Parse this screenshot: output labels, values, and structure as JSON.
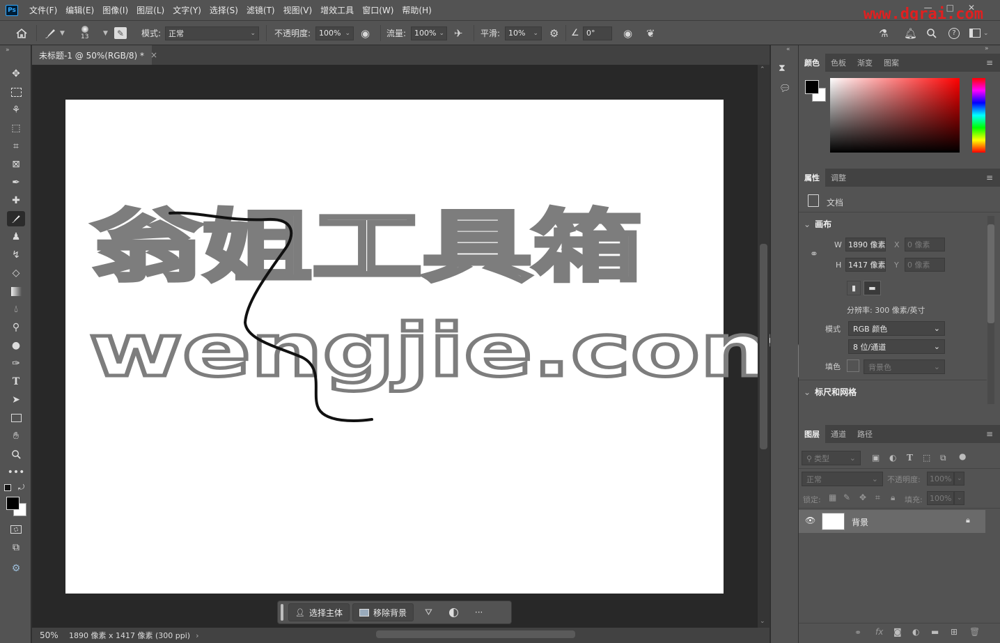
{
  "app": {
    "logo": "Ps",
    "watermark": "www.dgrai.com"
  },
  "menu": [
    "文件(F)",
    "编辑(E)",
    "图像(I)",
    "图层(L)",
    "文字(Y)",
    "选择(S)",
    "滤镜(T)",
    "视图(V)",
    "增效工具",
    "窗口(W)",
    "帮助(H)"
  ],
  "window_controls": {
    "minimize": "—",
    "restore": "□",
    "close": "✕"
  },
  "options": {
    "brush_size": "13",
    "mode_label": "模式:",
    "mode_value": "正常",
    "opacity_label": "不透明度:",
    "opacity_value": "100%",
    "flow_label": "流量:",
    "flow_value": "100%",
    "smooth_label": "平滑:",
    "smooth_value": "10%",
    "angle_value": "0°"
  },
  "document": {
    "tab_title": "未标题-1 @ 50%(RGB/8) *",
    "tab_close": "×",
    "canvas_text_line1": "翁姐工具箱",
    "canvas_text_line2": "wengjie.com"
  },
  "status": {
    "zoom": "50%",
    "info": "1890 像素 x 1417 像素 (300 ppi)",
    "arrow": "›"
  },
  "context_bar": {
    "select_subject": "选择主体",
    "remove_bg": "移除背景",
    "more": "···"
  },
  "color_panel": {
    "tabs": [
      "颜色",
      "色板",
      "渐变",
      "图案"
    ],
    "fg_color": "#000000",
    "bg_color": "#ffffff",
    "hue": "#ff0000"
  },
  "properties_panel": {
    "tabs": [
      "属性",
      "调整"
    ],
    "doc_label": "文档",
    "canvas_header": "画布",
    "w_label": "W",
    "w_value": "1890 像素",
    "h_label": "H",
    "h_value": "1417 像素",
    "x_label": "X",
    "x_value": "0 像素",
    "y_label": "Y",
    "y_value": "0 像素",
    "resolution": "分辨率: 300 像素/英寸",
    "mode_label": "模式",
    "mode_value": "RGB 颜色",
    "depth_value": "8 位/通道",
    "fill_label": "填色",
    "fill_value": "背景色",
    "rulers_header": "标尺和网格"
  },
  "layers_panel": {
    "tabs": [
      "图层",
      "通道",
      "路径"
    ],
    "filter_placeholder": "类型",
    "blend_mode": "正常",
    "opacity_label": "不透明度:",
    "opacity_value": "100%",
    "lock_label": "锁定:",
    "fill_label": "填充:",
    "fill_value": "100%",
    "layers": [
      {
        "name": "背景",
        "visible": true,
        "locked": true
      }
    ],
    "footer_fx": "fx"
  }
}
